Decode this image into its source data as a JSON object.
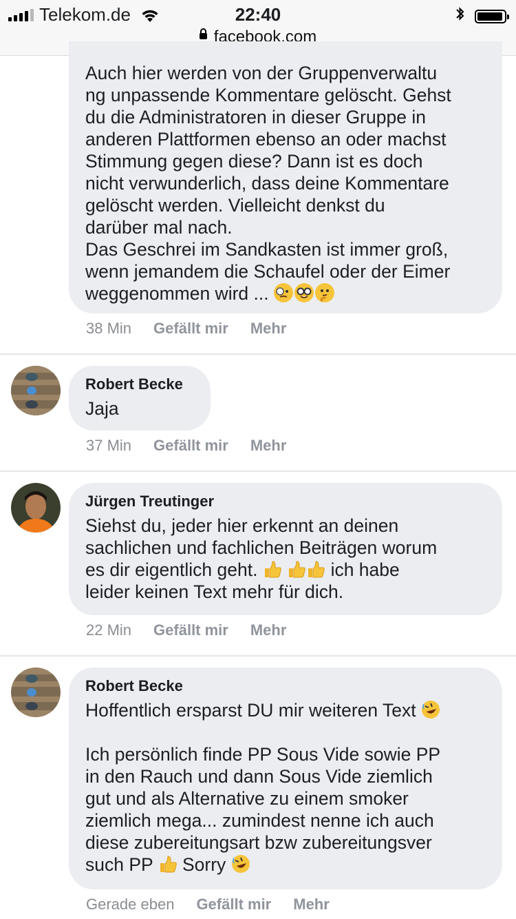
{
  "status": {
    "carrier": "Telekom.de",
    "time": "22:40",
    "url": "facebook.com",
    "battery_level": 0.9
  },
  "comments": [
    {
      "author": "",
      "text": "Auch hier werden von der Gruppenverwaltu\nng unpassende Kommentare gelöscht. Gehst\ndu die Administratoren in dieser Gruppe in\nanderen Plattformen ebenso an oder machst\nStimmung gegen diese? Dann ist es doch\nnicht verwunderlich, dass deine Kommentare\ngelöscht werden. Vielleicht denkst du\ndarüber mal nach.\nDas Geschrei im Sandkasten ist immer groß,\nwenn jemandem die Schaufel oder der Eimer\nweggenommen wird ...",
      "time": "38 Min",
      "like": "Gefällt mir",
      "more": "Mehr"
    },
    {
      "author": "Robert Becke",
      "text": "Jaja",
      "time": "37 Min",
      "like": "Gefällt mir",
      "more": "Mehr"
    },
    {
      "author": "Jürgen Treutinger",
      "text_a": "Siehst du, jeder hier erkennt an deinen\nsachlichen und fachlichen Beiträgen worum\nes dir eigentlich geht.",
      "text_b": "ich habe\nleider keinen Text mehr für dich.",
      "time": "22 Min",
      "like": "Gefällt mir",
      "more": "Mehr"
    },
    {
      "author": "Robert Becke",
      "text_a": "Hoffentlich ersparst DU mir weiteren Text",
      "text_b": "\n\nIch persönlich finde PP Sous Vide sowie PP\nin den Rauch und dann Sous Vide ziemlich\ngut und als Alternative zu einem smoker\nziemlich mega... zumindest nenne ich auch\ndiese zubereitungsart bzw zubereitungsver\nsuch PP",
      "text_c": "Sorry",
      "time": "Gerade eben",
      "like": "Gefällt mir",
      "more": "Mehr"
    }
  ],
  "icons": {
    "signal": "signal-icon",
    "wifi": "wifi-icon",
    "bluetooth": "bluetooth-icon",
    "battery": "battery-icon",
    "lock": "lock-icon",
    "emoji_monocle": "monocle-face-emoji",
    "emoji_nerd": "nerd-face-emoji",
    "emoji_thinking": "thinking-face-emoji",
    "emoji_thumbs": "thumbs-up-emoji",
    "emoji_rofl": "rolling-on-floor-laughing-emoji"
  }
}
